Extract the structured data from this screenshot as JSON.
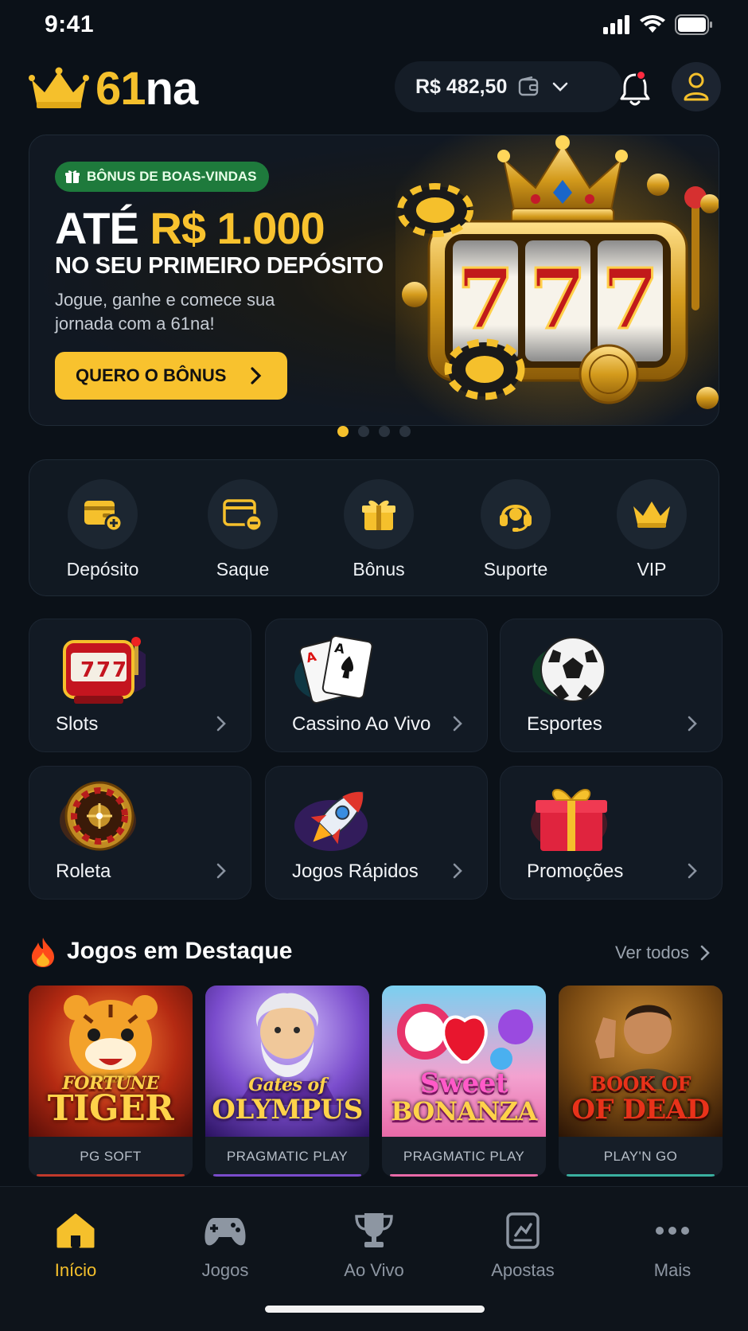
{
  "status": {
    "time": "9:41"
  },
  "header": {
    "logo_text_gold": "61",
    "logo_text_white": "na",
    "balance": "R$ 482,50"
  },
  "banner": {
    "badge": "BÔNUS DE BOAS-VINDAS",
    "title_prefix": "ATÉ ",
    "title_amount": "R$ 1.000",
    "subtitle": "NO SEU PRIMEIRO DEPÓSITO",
    "description": "Jogue, ganhe e comece sua jornada com a 61na!",
    "cta": "QUERO O BÔNUS",
    "slot_symbols": [
      "7",
      "7",
      "7"
    ]
  },
  "quick_actions": [
    {
      "label": "Depósito",
      "icon": "wallet-plus-icon"
    },
    {
      "label": "Saque",
      "icon": "wallet-minus-icon"
    },
    {
      "label": "Bônus",
      "icon": "gift-icon"
    },
    {
      "label": "Suporte",
      "icon": "headset-icon"
    },
    {
      "label": "VIP",
      "icon": "crown-icon"
    }
  ],
  "categories": [
    {
      "label": "Slots",
      "icon": "slot-machine-icon"
    },
    {
      "label": "Cassino Ao Vivo",
      "icon": "playing-cards-icon"
    },
    {
      "label": "Esportes",
      "icon": "soccer-ball-icon"
    },
    {
      "label": "Roleta",
      "icon": "roulette-icon"
    },
    {
      "label": "Jogos Rápidos",
      "icon": "rocket-icon"
    },
    {
      "label": "Promoções",
      "icon": "gift-box-icon"
    }
  ],
  "featured": {
    "title": "Jogos em Destaque",
    "see_all": "Ver todos",
    "games": [
      {
        "name_line1": "FORTUNE",
        "name_line2": "TIGER",
        "provider": "PG SOFT"
      },
      {
        "name_line1": "Gates of",
        "name_line2": "OLYMPUS",
        "provider": "PRAGMATIC PLAY"
      },
      {
        "name_line1": "Sweet",
        "name_line2": "BONANZA",
        "provider": "PRAGMATIC PLAY"
      },
      {
        "name_line1": "BOOK OF",
        "name_line2": "OF DEAD",
        "provider": "PLAY'N GO"
      }
    ]
  },
  "nav": [
    {
      "label": "Início",
      "icon": "home-icon",
      "active": true
    },
    {
      "label": "Jogos",
      "icon": "gamepad-icon",
      "active": false
    },
    {
      "label": "Ao Vivo",
      "icon": "trophy-icon",
      "active": false
    },
    {
      "label": "Apostas",
      "icon": "ticket-icon",
      "active": false
    },
    {
      "label": "Mais",
      "icon": "more-icon",
      "active": false
    }
  ],
  "colors": {
    "accent": "#f5c02c",
    "background": "#0b1118",
    "badge_green": "#1e7a3c"
  }
}
